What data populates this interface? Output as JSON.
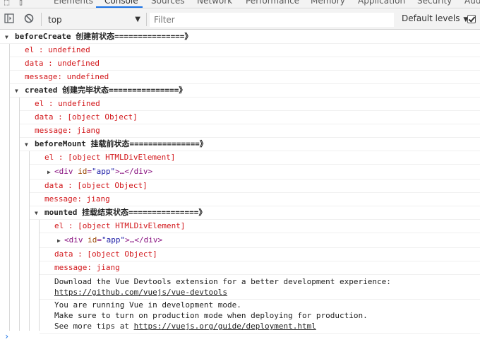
{
  "tabs": [
    {
      "label": "Elements",
      "active": false
    },
    {
      "label": "Console",
      "active": true
    },
    {
      "label": "Sources",
      "active": false
    },
    {
      "label": "Network",
      "active": false
    },
    {
      "label": "Performance",
      "active": false
    },
    {
      "label": "Memory",
      "active": false
    },
    {
      "label": "Application",
      "active": false
    },
    {
      "label": "Security",
      "active": false
    },
    {
      "label": "Aud",
      "active": false
    }
  ],
  "toolbar": {
    "context": "top",
    "filter_placeholder": "Filter",
    "levels_label": "Default levels",
    "checkbox_checked": true
  },
  "console": {
    "before_create": {
      "group": "beforeCreate 创建前状态===============》",
      "el": "el     : undefined",
      "data": "data   : undefined",
      "message": "message: undefined"
    },
    "created": {
      "group": "created 创建完毕状态===============》",
      "el": "el     : undefined",
      "data": "data   : [object Object]",
      "message": "message: jiang"
    },
    "before_mount": {
      "group": "beforeMount 挂载前状态===============》",
      "el": "el     : [object HTMLDivElement]",
      "node_open": "<div",
      "node_attr": "id",
      "node_eq": "=",
      "node_val": "\"app\"",
      "node_close": ">…</div>",
      "data": "data   : [object Object]",
      "message": "message: jiang"
    },
    "mounted": {
      "group": "mounted 挂载结束状态===============》",
      "el": "el     : [object HTMLDivElement]",
      "node_open": "<div",
      "node_attr": "id",
      "node_eq": "=",
      "node_val": "\"app\"",
      "node_close": ">…</div>",
      "data": "data   : [object Object]",
      "message": "message: jiang"
    },
    "devtools": {
      "line1": "Download the Vue Devtools extension for a better development experience:",
      "link": "https://github.com/vuejs/vue-devtools"
    },
    "devmode": {
      "line1": "You are running Vue in development mode.",
      "line2": "Make sure to turn on production mode when deploying for production.",
      "line3_prefix": "See more tips at ",
      "link": "https://vuejs.org/guide/deployment.html"
    },
    "prompt": "›"
  }
}
